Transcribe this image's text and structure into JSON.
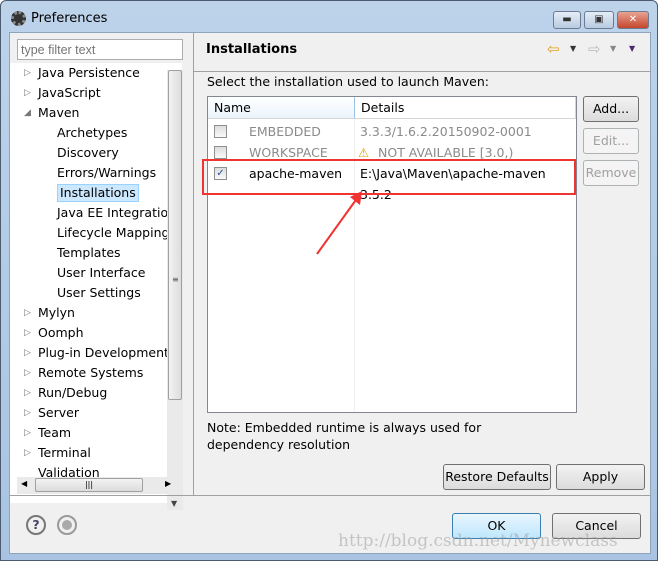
{
  "window": {
    "title": "Preferences",
    "minimize": "minimize",
    "maximize": "maximize",
    "close": "close"
  },
  "sidebar": {
    "filter_placeholder": "type filter text",
    "items": [
      {
        "label": "Java Persistence",
        "level": 0,
        "expander": "collapsed"
      },
      {
        "label": "JavaScript",
        "level": 0,
        "expander": "collapsed"
      },
      {
        "label": "Maven",
        "level": 0,
        "expander": "expanded"
      },
      {
        "label": "Archetypes",
        "level": 1
      },
      {
        "label": "Discovery",
        "level": 1
      },
      {
        "label": "Errors/Warnings",
        "level": 1
      },
      {
        "label": "Installations",
        "level": 1,
        "selected": true
      },
      {
        "label": "Java EE Integration",
        "level": 1
      },
      {
        "label": "Lifecycle Mapping",
        "level": 1
      },
      {
        "label": "Templates",
        "level": 1
      },
      {
        "label": "User Interface",
        "level": 1
      },
      {
        "label": "User Settings",
        "level": 1
      },
      {
        "label": "Mylyn",
        "level": 0,
        "expander": "collapsed"
      },
      {
        "label": "Oomph",
        "level": 0,
        "expander": "collapsed"
      },
      {
        "label": "Plug-in Development",
        "level": 0,
        "expander": "collapsed"
      },
      {
        "label": "Remote Systems",
        "level": 0,
        "expander": "collapsed"
      },
      {
        "label": "Run/Debug",
        "level": 0,
        "expander": "collapsed"
      },
      {
        "label": "Server",
        "level": 0,
        "expander": "collapsed"
      },
      {
        "label": "Team",
        "level": 0,
        "expander": "collapsed"
      },
      {
        "label": "Terminal",
        "level": 0,
        "expander": "collapsed"
      },
      {
        "label": "Validation",
        "level": 0
      }
    ]
  },
  "main": {
    "title": "Installations",
    "description": "Select the installation used to launch Maven:",
    "columns": [
      "Name",
      "Details"
    ],
    "rows": [
      {
        "name": "EMBEDDED",
        "details": "3.3.3/1.6.2.20150902-0001",
        "checked": false,
        "disabled": true
      },
      {
        "name": "WORKSPACE",
        "details": "NOT AVAILABLE [3.0,)",
        "checked": false,
        "disabled": true,
        "icon": "warning-icon"
      },
      {
        "name": "apache-maven",
        "details": "E:\\Java\\Maven\\apache-maven 3.5.2",
        "checked": true,
        "disabled": false
      }
    ],
    "buttons": {
      "add": "Add...",
      "edit": "Edit...",
      "remove": "Remove"
    },
    "note": "Note: Embedded runtime is always used for dependency resolution",
    "restore_defaults": "Restore Defaults",
    "apply": "Apply"
  },
  "footer": {
    "ok": "OK",
    "cancel": "Cancel"
  },
  "watermark": "http://blog.csdn.net/Mynewclass",
  "colors": {
    "highlight": "#f03333",
    "selection": "#cce8ff"
  }
}
